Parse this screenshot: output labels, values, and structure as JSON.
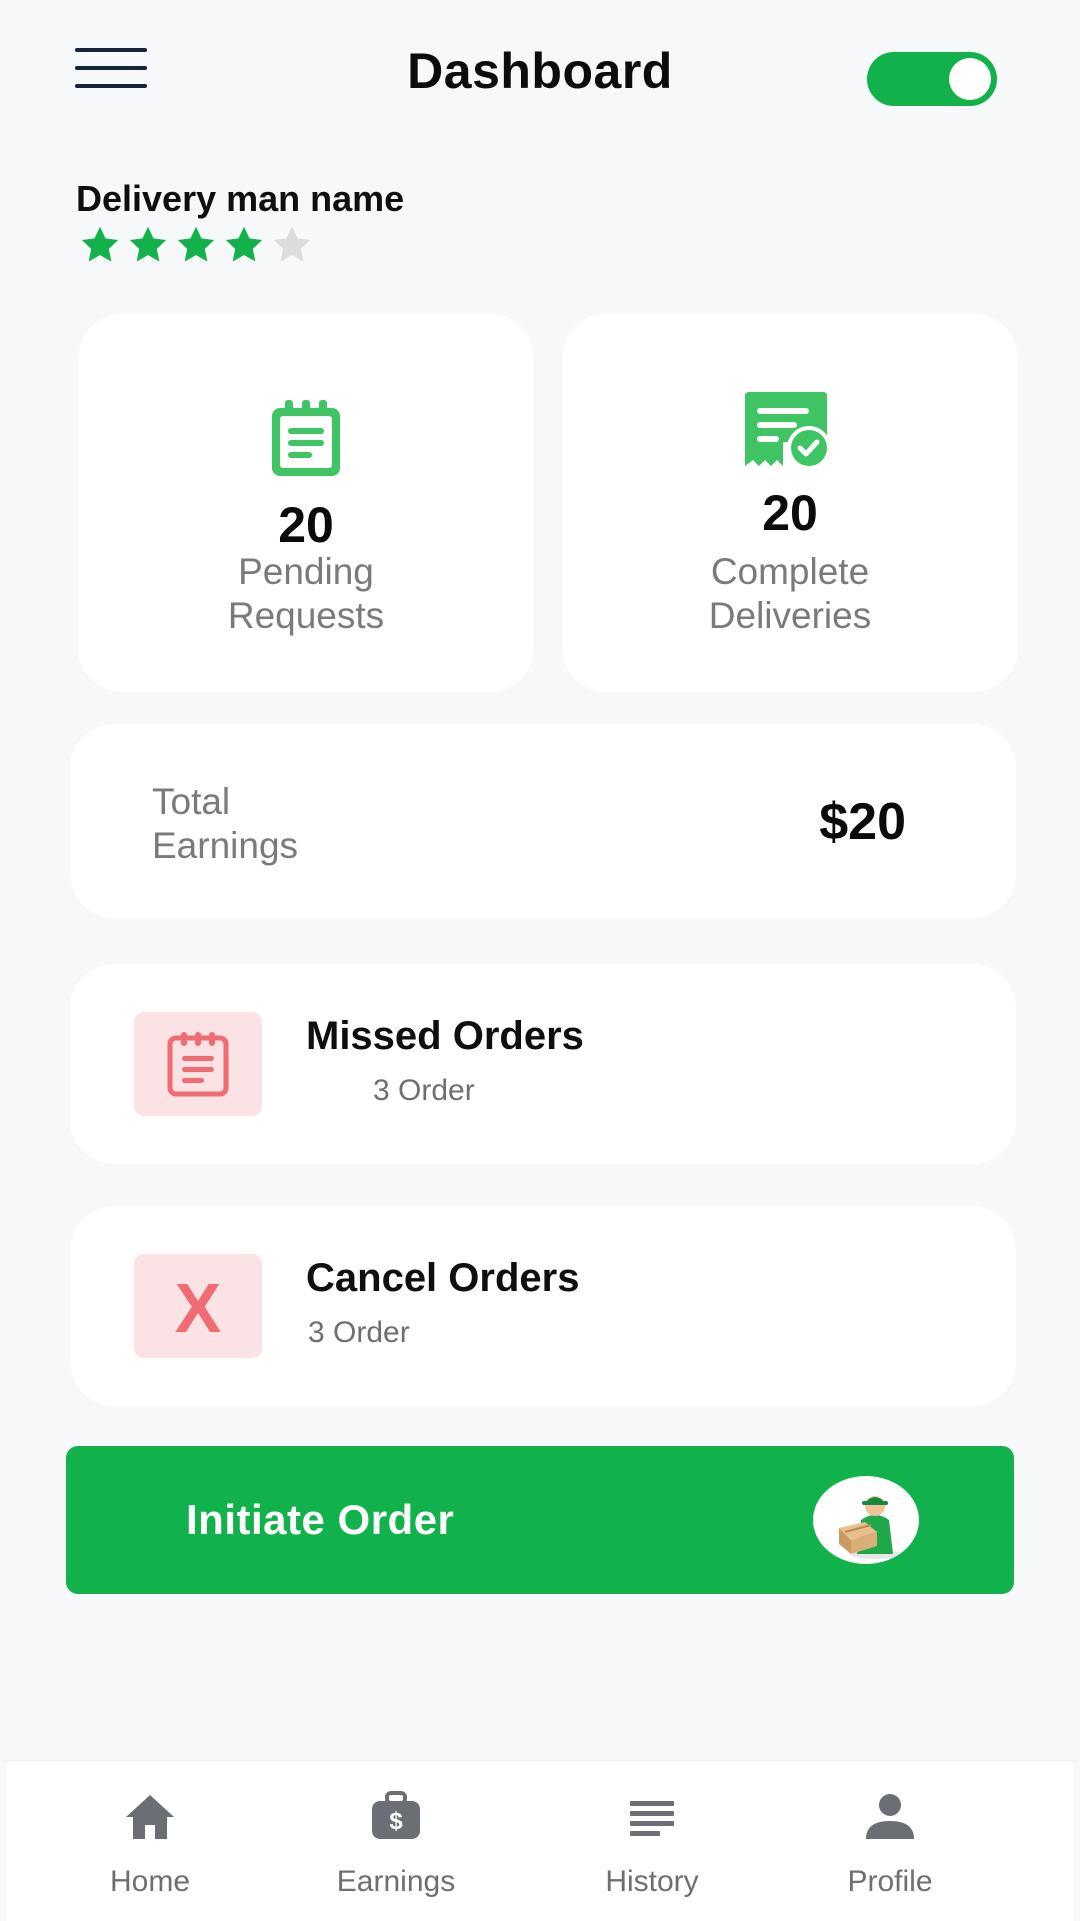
{
  "header": {
    "title": "Dashboard",
    "online_toggle": {
      "on": true,
      "color": "#11b24c"
    }
  },
  "driver": {
    "name": "Delivery man name",
    "rating": {
      "value": 4,
      "max": 5
    }
  },
  "stats": {
    "pending": {
      "count": "20",
      "label_line1": "Pending",
      "label_line2": "Requests",
      "icon": "clipboard-icon"
    },
    "complete": {
      "count": "20",
      "label_line1": "Complete",
      "label_line2": "Deliveries",
      "icon": "receipt-check-icon"
    }
  },
  "earnings": {
    "label_line1": "Total",
    "label_line2": "Earnings",
    "value": "$20"
  },
  "orders": {
    "missed": {
      "title": "Missed Orders",
      "count_text": "3 Order",
      "icon": "clipboard-icon"
    },
    "cancel": {
      "title": "Cancel Orders",
      "count_text": "3 Order",
      "icon_text": "X"
    }
  },
  "cta": {
    "label": "Initiate Order",
    "icon": "delivery-man-icon"
  },
  "nav": {
    "items": [
      {
        "label": "Home",
        "icon": "home-icon"
      },
      {
        "label": "Earnings",
        "icon": "wallet-dollar-icon"
      },
      {
        "label": "History",
        "icon": "list-icon"
      },
      {
        "label": "Profile",
        "icon": "person-icon"
      }
    ]
  },
  "colors": {
    "accent": "#11b24c",
    "icon_green": "#3ec463",
    "danger": "#f16b72",
    "danger_bg": "#fbe2e4",
    "star_off": "#dcdcdc"
  }
}
